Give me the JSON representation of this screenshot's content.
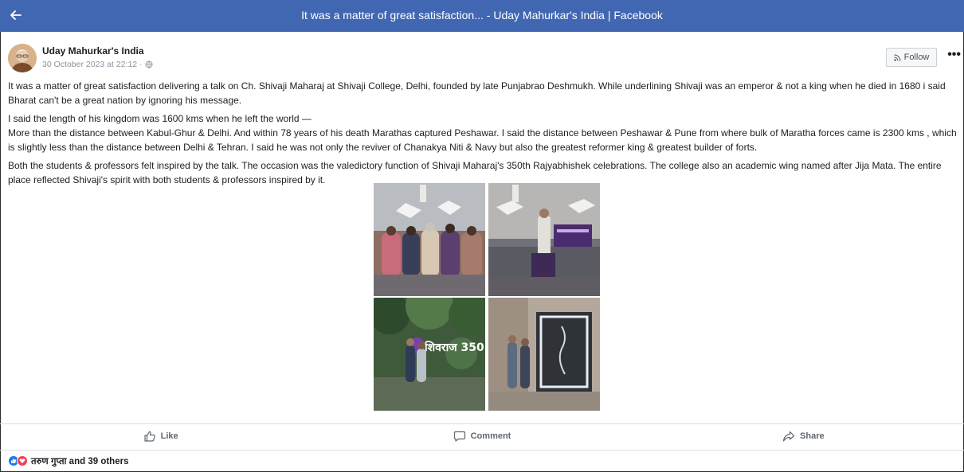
{
  "window": {
    "title": "It was a matter of great satisfaction... - Uday Mahurkar's India | Facebook"
  },
  "header": {
    "author": "Uday Mahurkar's India",
    "timestamp": "30 October 2023 at 22:12 ·",
    "follow_label": "Follow",
    "more_label": "•••"
  },
  "post": {
    "paragraphs": [
      "It was a matter of great satisfaction delivering a talk on Ch. Shivaji Maharaj at Shivaji College, Delhi, founded by late Punjabrao Deshmukh. While underlining Shivaji was an emperor & not a king when he died in 1680 i said Bharat can't be a great nation by ignoring his message.",
      "I said the length of his kingdom was 1600 kms when he left the world —",
      "More than the distance between Kabul-Ghur & Delhi. And within 78 years of his death Marathas captured Peshawar. I said the distance between Peshawar & Pune from where bulk of Maratha forces came is 2300 kms , which is slightly less than the distance between Delhi & Tehran. I said he was not only the reviver of Chanakya Niti & Navy but also the greatest reformer king & greatest builder of forts.",
      "Both the students & professors felt inspired by the talk. The occasion was the valedictory function of Shivaji Maharaj's 350th Rajyabhishek celebrations. The college also an academic wing named after Jija Mata. The entire place reflected Shivaji's spirit with both students & professors inspired by it."
    ]
  },
  "gallery": {
    "sign_text": "शिवराज 350"
  },
  "actions": {
    "like": "Like",
    "comment": "Comment",
    "share": "Share"
  },
  "reactions": {
    "summary": "तरुण गुप्ता and 39 others"
  },
  "colors": {
    "brand": "#4267b2",
    "like": "#1877f2",
    "love": "#f33e58"
  }
}
